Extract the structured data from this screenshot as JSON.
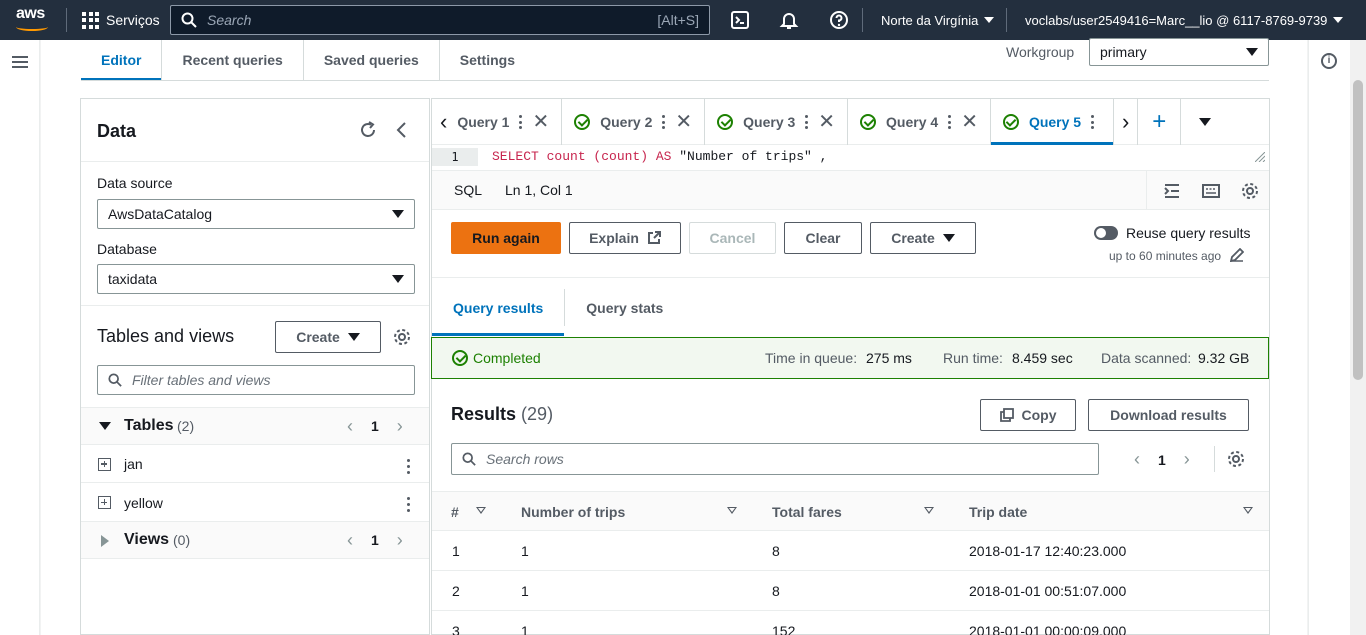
{
  "nav": {
    "logo": "aws",
    "services": "Serviços",
    "search_placeholder": "Search",
    "search_shortcut": "[Alt+S]",
    "region": "Norte da Virgínia",
    "account": "voclabs/user2549416=Marc__lio @ 6117-8769-9739"
  },
  "top_tabs": [
    "Editor",
    "Recent queries",
    "Saved queries",
    "Settings"
  ],
  "workgroup": {
    "label": "Workgroup",
    "value": "primary"
  },
  "data_panel": {
    "title": "Data",
    "data_source_label": "Data source",
    "data_source_value": "AwsDataCatalog",
    "database_label": "Database",
    "database_value": "taxidata",
    "tables_views_title": "Tables and views",
    "create_label": "Create",
    "filter_placeholder": "Filter tables and views",
    "tables_label": "Tables",
    "tables_count": "(2)",
    "tables_page": "1",
    "tables": [
      "jan",
      "yellow"
    ],
    "views_label": "Views",
    "views_count": "(0)",
    "views_page": "1"
  },
  "query_tabs": [
    {
      "label": "Query 1"
    },
    {
      "label": "Query 2"
    },
    {
      "label": "Query 3"
    },
    {
      "label": "Query 4"
    },
    {
      "label": "Query 5"
    }
  ],
  "editor": {
    "line_no": "1",
    "code_kw1": "SELECT count (count) AS ",
    "code_str": "\"Number of trips\"",
    "code_rest": " ,",
    "lang": "SQL",
    "cursor": "Ln 1, Col 1"
  },
  "toolbar": {
    "run": "Run again",
    "explain": "Explain",
    "cancel": "Cancel",
    "clear": "Clear",
    "create": "Create",
    "reuse": "Reuse query results",
    "reuse_sub": "up to 60 minutes ago"
  },
  "result_tabs": [
    "Query results",
    "Query stats"
  ],
  "status": {
    "completed": "Completed",
    "queue_label": "Time in queue:",
    "queue_value": "275 ms",
    "run_label": "Run time:",
    "run_value": "8.459 sec",
    "scanned_label": "Data scanned:",
    "scanned_value": "9.32 GB"
  },
  "results": {
    "title": "Results",
    "count": "(29)",
    "copy": "Copy",
    "download": "Download results",
    "search_placeholder": "Search rows",
    "page": "1",
    "columns": [
      "#",
      "Number of trips",
      "Total fares",
      "Trip date"
    ],
    "rows": [
      [
        "1",
        "1",
        "8",
        "2018-01-17 12:40:23.000"
      ],
      [
        "2",
        "1",
        "8",
        "2018-01-01 00:51:07.000"
      ],
      [
        "3",
        "1",
        "152",
        "2018-01-01 00:00:09.000"
      ]
    ]
  }
}
